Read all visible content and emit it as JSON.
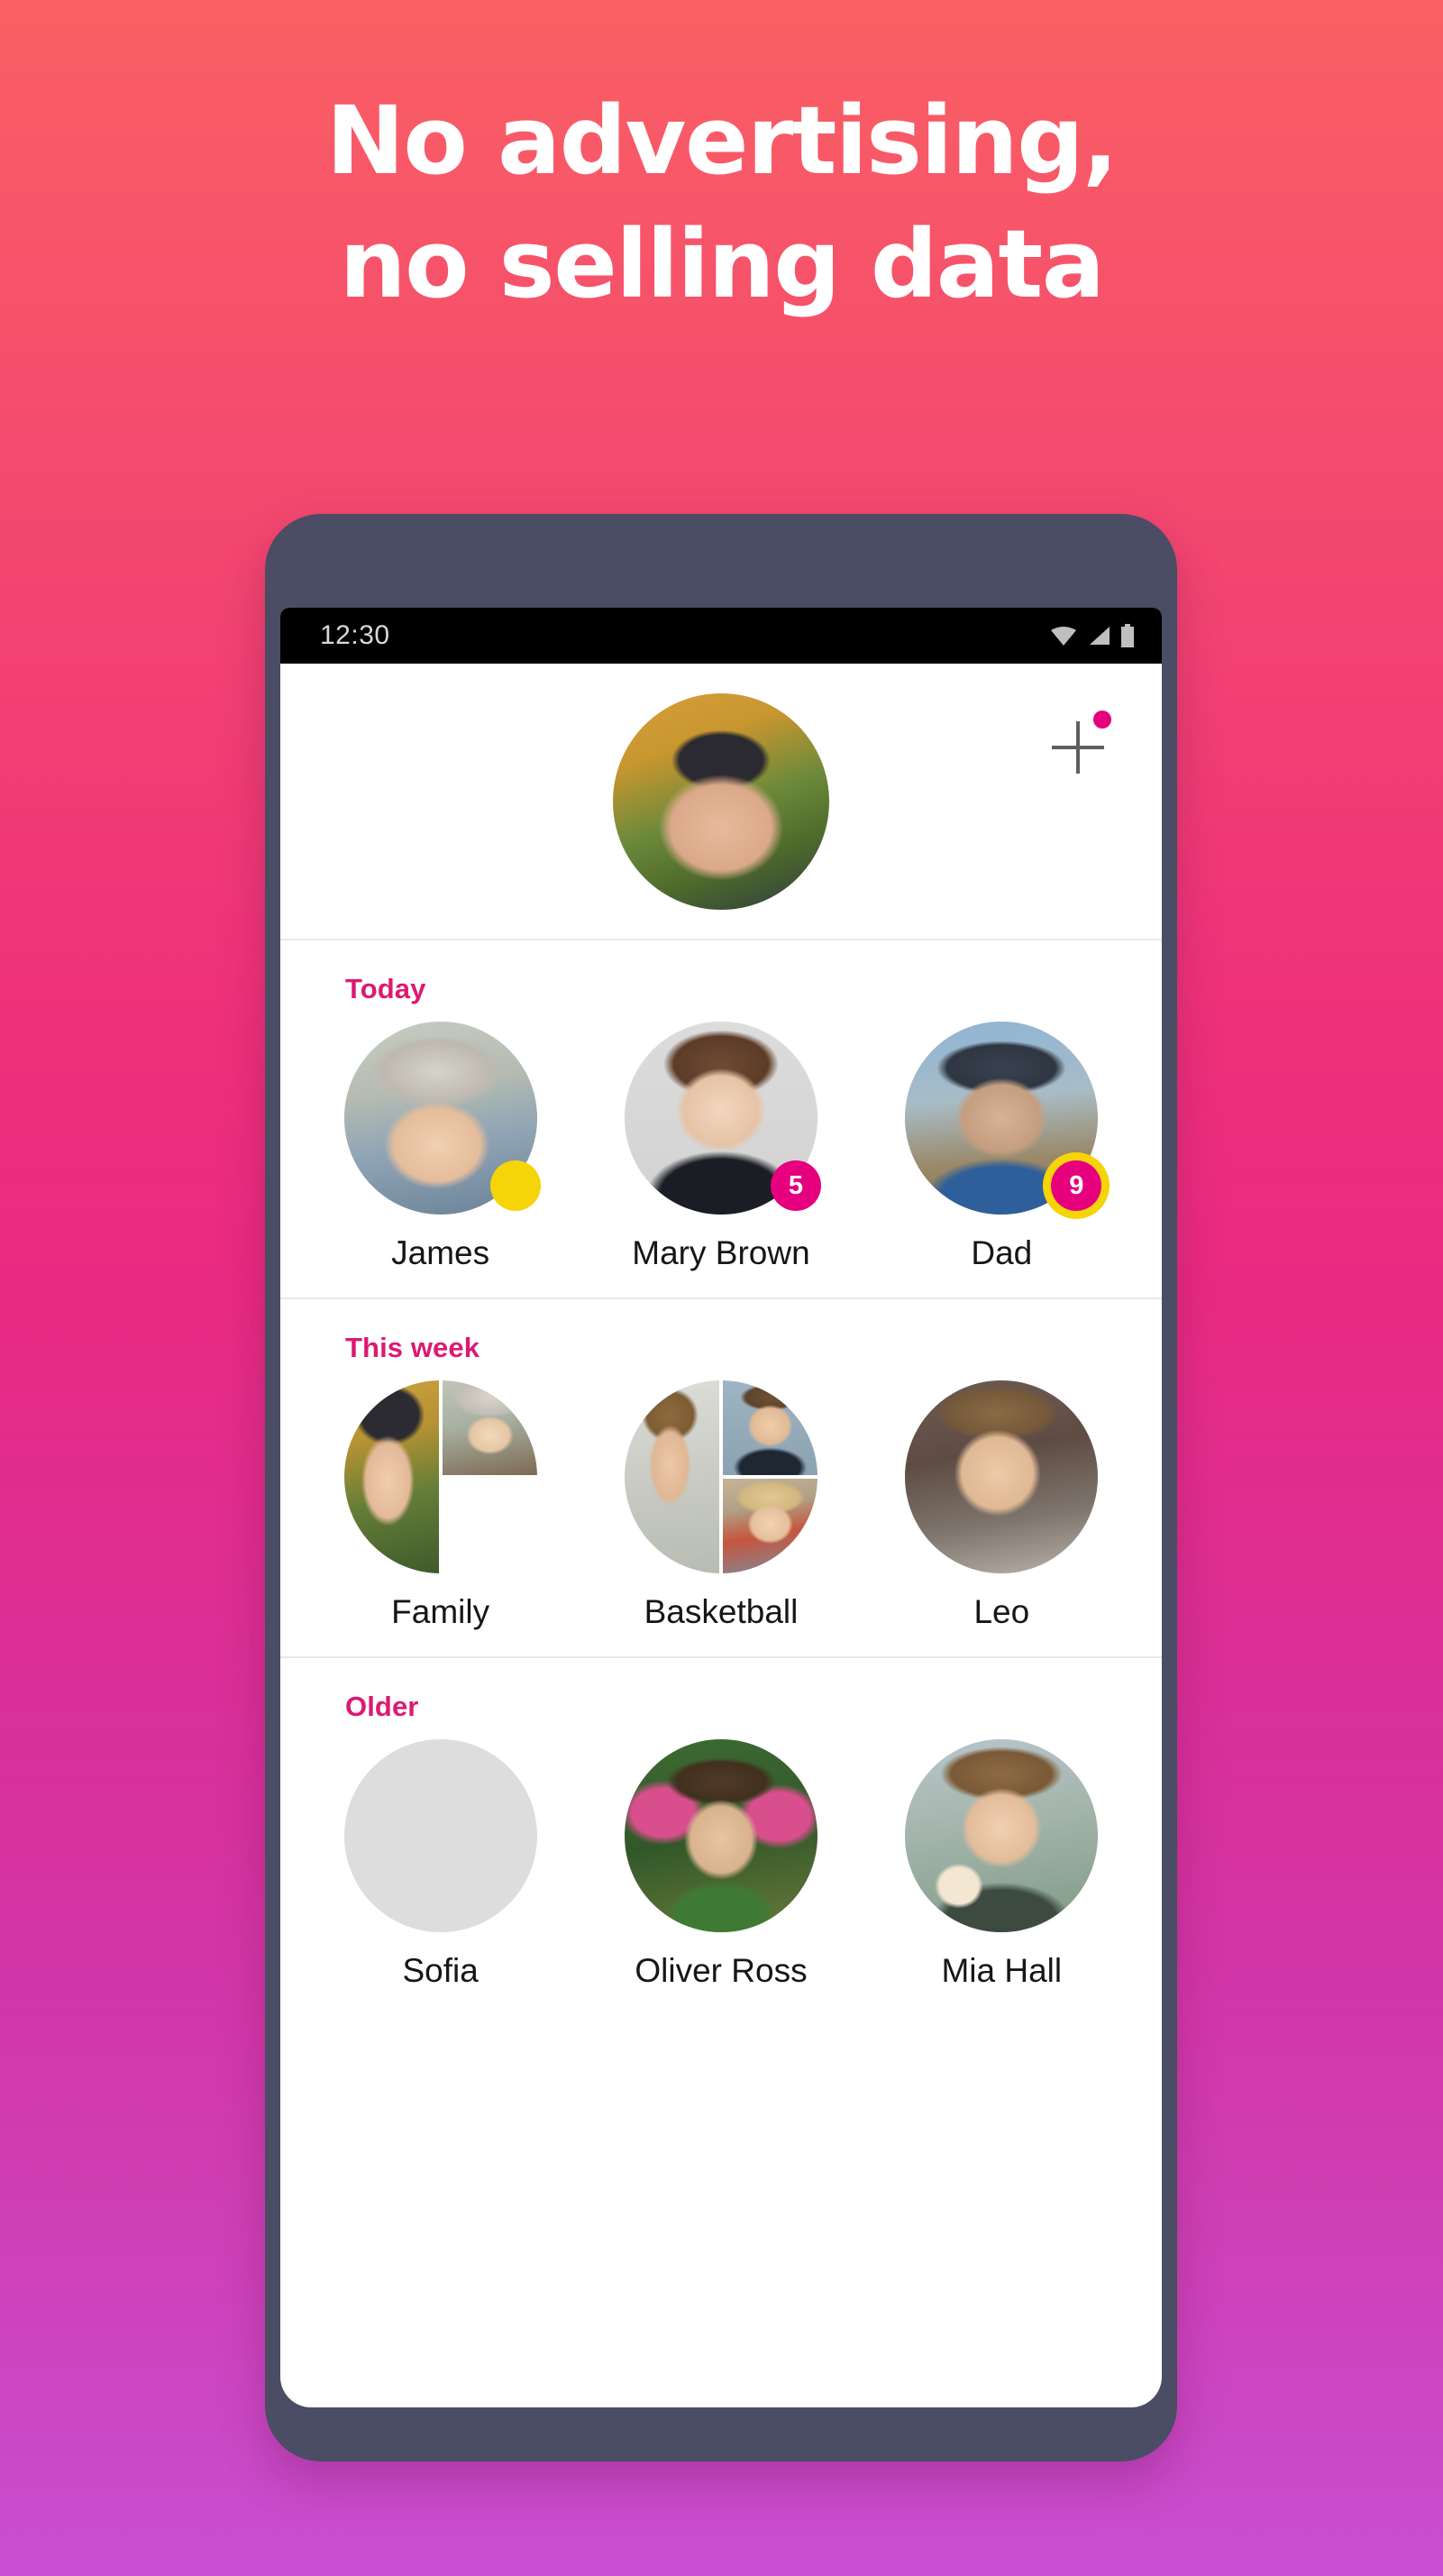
{
  "promo": {
    "headline": "No advertising,\nno selling data"
  },
  "colors": {
    "gradient_top": "#FA6064",
    "gradient_mid": "#E92A82",
    "gradient_bottom": "#C84FD2",
    "accent_pink": "#E6007E",
    "section_label": "#DC1A72",
    "badge_yellow": "#F5D408",
    "phone_frame": "#4A4D63"
  },
  "phone": {
    "status_bar": {
      "time": "12:30",
      "icons": [
        "wifi-icon",
        "cellular-signal-icon",
        "battery-icon"
      ]
    },
    "header": {
      "avatar_name": "my-profile-avatar",
      "add_button_label": "+",
      "add_button_badge": true
    },
    "sections": [
      {
        "title": "Today",
        "contacts": [
          {
            "name": "James",
            "photo": "ph-james",
            "badge": {
              "text": "",
              "style": "yellow"
            },
            "group": false
          },
          {
            "name": "Mary Brown",
            "photo": "ph-mary",
            "badge": {
              "text": "5",
              "style": "pink"
            },
            "group": false
          },
          {
            "name": "Dad",
            "photo": "ph-dad",
            "badge": {
              "text": "9",
              "style": "ringed"
            },
            "group": false
          }
        ]
      },
      {
        "title": "This week",
        "contacts": [
          {
            "name": "Family",
            "photo": "ph-woman1",
            "photo2": "ph-kid",
            "photo3": "ph-bubbles",
            "badge": null,
            "group": true
          },
          {
            "name": "Basketball",
            "photo": "ph-hipster",
            "photo2": "ph-glasses",
            "photo3": "ph-blonde",
            "badge": null,
            "group": true
          },
          {
            "name": "Leo",
            "photo": "ph-leo",
            "badge": null,
            "group": false
          }
        ]
      },
      {
        "title": "Older",
        "contacts": [
          {
            "name": "Sofia",
            "photo": "ph-sofia",
            "badge": null,
            "group": false
          },
          {
            "name": "Oliver Ross",
            "photo": "ph-flowers",
            "badge": null,
            "group": false
          },
          {
            "name": "Mia Hall",
            "photo": "ph-mia",
            "badge": null,
            "group": false
          }
        ]
      }
    ]
  }
}
